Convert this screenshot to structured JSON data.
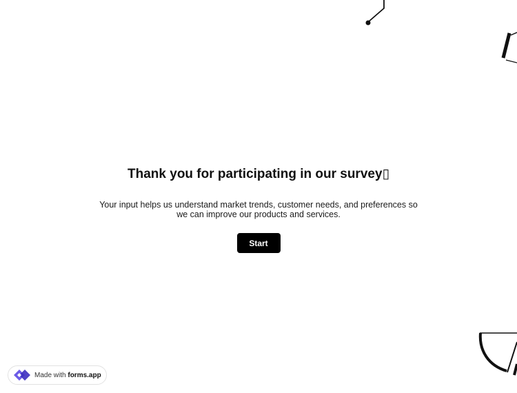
{
  "survey": {
    "title": "Thank you for participating in our survey▯",
    "description": "Your input helps us understand market trends, customer needs, and preferences so we can improve our products and services.",
    "start_label": "Start"
  },
  "badge": {
    "prefix": "Made with ",
    "brand": "forms.app"
  },
  "icons": {
    "badge_logo": "forms-app-logo-icon"
  },
  "colors": {
    "button_background": "#000000",
    "button_text": "#ffffff",
    "logo_primary": "#6c5ce7",
    "logo_secondary": "#3d2fc0"
  }
}
